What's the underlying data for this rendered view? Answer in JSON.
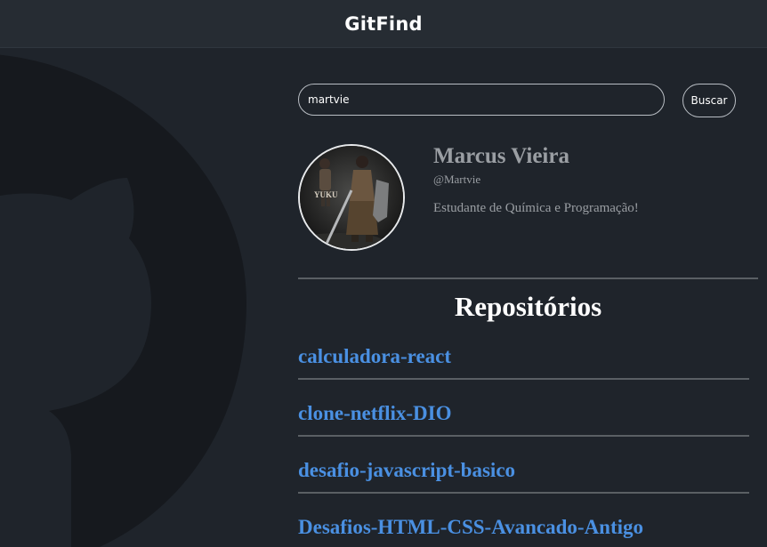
{
  "header": {
    "title": "GitFind"
  },
  "search": {
    "value": "martvie",
    "button_label": "Buscar"
  },
  "profile": {
    "name": "Marcus Vieira",
    "handle": "@Martvie",
    "bio": "Estudante de Química e Programação!",
    "avatar_caption": "YUKU"
  },
  "repositories": {
    "heading": "Repositórios",
    "items": [
      {
        "name": "calculadora-react"
      },
      {
        "name": "clone-netflix-DIO"
      },
      {
        "name": "desafio-javascript-basico"
      },
      {
        "name": "Desafios-HTML-CSS-Avancado-Antigo"
      }
    ]
  },
  "colors": {
    "background": "#1f242b",
    "header": "#262c33",
    "link": "#4a90e2",
    "muted_text": "#9a9ea3"
  }
}
